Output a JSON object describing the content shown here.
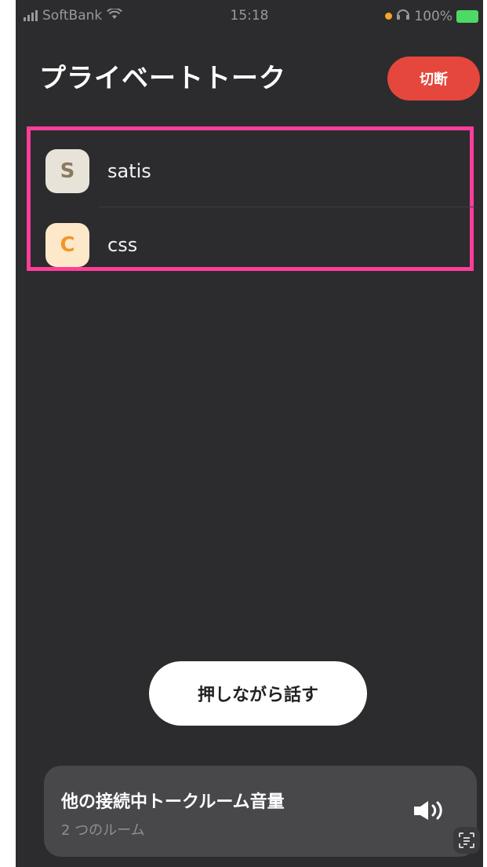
{
  "status_bar": {
    "carrier": "SoftBank",
    "time": "15:18",
    "battery": "100%"
  },
  "header": {
    "title": "プライベートトーク",
    "disconnect_label": "切断"
  },
  "members": [
    {
      "initial": "S",
      "name": "satis",
      "avatar_bg": "#e8e3d9",
      "avatar_fg": "#8a7a5e"
    },
    {
      "initial": "C",
      "name": "css",
      "avatar_bg": "#fde9c9",
      "avatar_fg": "#f0962a"
    }
  ],
  "push_to_talk": {
    "label": "押しながら話す"
  },
  "volume_card": {
    "title": "他の接続中トークルーム音量",
    "subtitle": "2 つのルーム"
  },
  "colors": {
    "background": "#2c2c2e",
    "accent_red": "#e5473d",
    "highlight_pink": "#ff3d9a"
  },
  "icons": [
    "signal-icon",
    "wifi-icon",
    "location-dot-icon",
    "headphones-icon",
    "battery-icon",
    "speaker-icon",
    "scan-icon"
  ]
}
